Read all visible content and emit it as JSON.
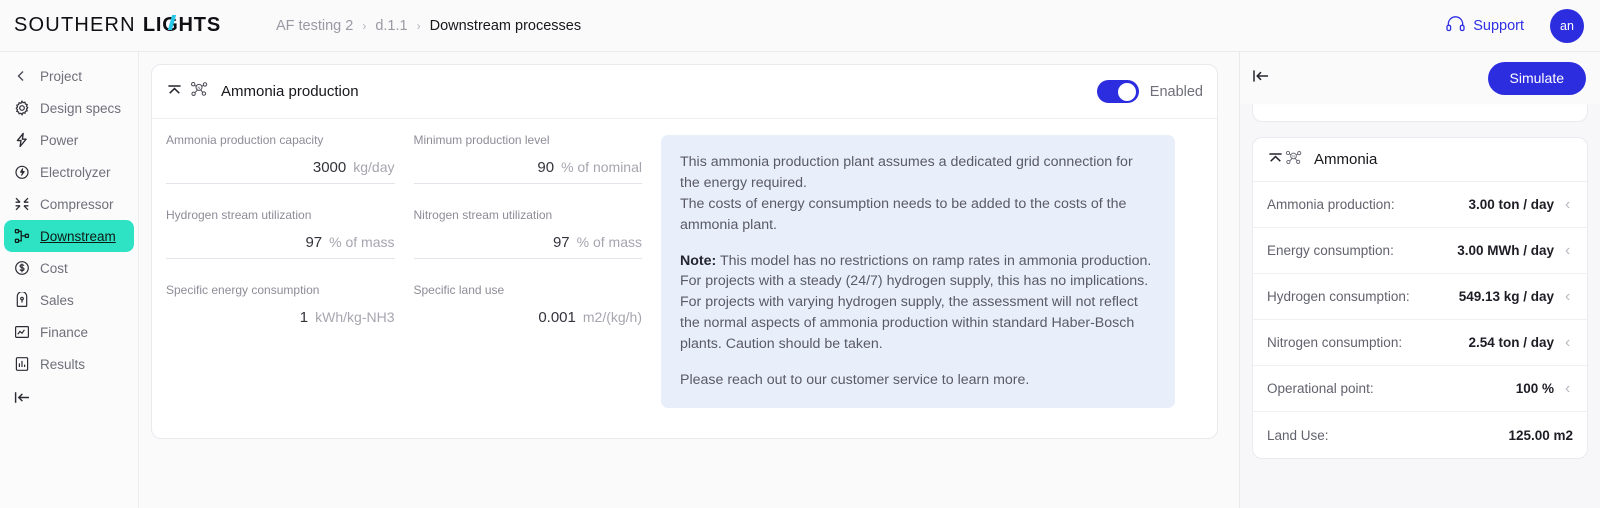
{
  "brand": {
    "word1": "SOUTHERN",
    "word2": "LIGHTS",
    "accent": "#29c7e8"
  },
  "breadcrumb": {
    "items": [
      "AF testing 2",
      "d.1.1",
      "Downstream processes"
    ],
    "separator": "›"
  },
  "header": {
    "support_label": "Support",
    "support_icon": "headset-icon",
    "avatar_initials": "an"
  },
  "sidebar": {
    "collapse_icon": "collapse-panel-icon",
    "items": [
      {
        "label": "Project",
        "icon": "chevron-left-icon",
        "active": false
      },
      {
        "label": "Design specs",
        "icon": "gear-icon",
        "active": false
      },
      {
        "label": "Power",
        "icon": "bolt-icon",
        "active": false
      },
      {
        "label": "Electrolyzer",
        "icon": "droplet-bolt-icon",
        "active": false
      },
      {
        "label": "Compressor",
        "icon": "compress-icon",
        "active": false
      },
      {
        "label": "Downstream",
        "icon": "nodes-icon",
        "active": true
      },
      {
        "label": "Cost",
        "icon": "dollar-circle-icon",
        "active": false
      },
      {
        "label": "Sales",
        "icon": "tag-icon",
        "active": false
      },
      {
        "label": "Finance",
        "icon": "line-chart-icon",
        "active": false
      },
      {
        "label": "Results",
        "icon": "bar-chart-doc-icon",
        "active": false
      }
    ],
    "active_accent": "#2ee3c3"
  },
  "card": {
    "collapse_icon": "chevron-up-icon",
    "module_icon": "ammonia-molecule-icon",
    "title": "Ammonia production",
    "toggle": {
      "label": "Enabled",
      "on": true,
      "color": "#2d2de0"
    },
    "fields": [
      {
        "label": "Ammonia production capacity",
        "value": "3000",
        "unit": "kg/day"
      },
      {
        "label": "Minimum production level",
        "value": "90",
        "unit": "% of nominal"
      },
      {
        "label": "Hydrogen stream utilization",
        "value": "97",
        "unit": "% of mass"
      },
      {
        "label": "Nitrogen stream utilization",
        "value": "97",
        "unit": "% of mass"
      },
      {
        "label": "Specific energy consumption",
        "value": "1",
        "unit": "kWh/kg-NH3"
      },
      {
        "label": "Specific land use",
        "value": "0.001",
        "unit": "m2/(kg/h)"
      }
    ],
    "info": {
      "background": "#e8effb",
      "paragraph1": "This ammonia production plant assumes a dedicated grid connection for the energy required.\nThe costs of energy consumption needs to be added to the costs of the ammonia plant.",
      "note_label": "Note:",
      "note_body": " This model has no restrictions on ramp rates in ammonia production. For projects with a steady (24/7) hydrogen supply, this has no implications. For projects with varying hydrogen supply, the assessment will not reflect the normal aspects of ammonia production within standard Haber-Bosch plants. Caution should be taken.",
      "paragraph3": "Please reach out to our customer service to learn more."
    }
  },
  "right_panel": {
    "collapse_icon": "collapse-panel-icon",
    "simulate_label": "Simulate",
    "simulate_color": "#2d2de0",
    "summary_card": {
      "collapse_icon": "chevron-up-icon",
      "module_icon": "ammonia-molecule-icon",
      "title": "Ammonia",
      "rows": [
        {
          "key": "Ammonia production:",
          "value": "3.00 ton / day",
          "caret": "‹"
        },
        {
          "key": "Energy consumption:",
          "value": "3.00 MWh / day",
          "caret": "‹"
        },
        {
          "key": "Hydrogen consumption:",
          "value": "549.13 kg / day",
          "caret": "‹"
        },
        {
          "key": "Nitrogen consumption:",
          "value": "2.54 ton / day",
          "caret": "‹"
        },
        {
          "key": "Operational point:",
          "value": "100 %",
          "caret": "‹"
        },
        {
          "key": "Land Use:",
          "value": "125.00 m2",
          "caret": ""
        }
      ]
    }
  }
}
